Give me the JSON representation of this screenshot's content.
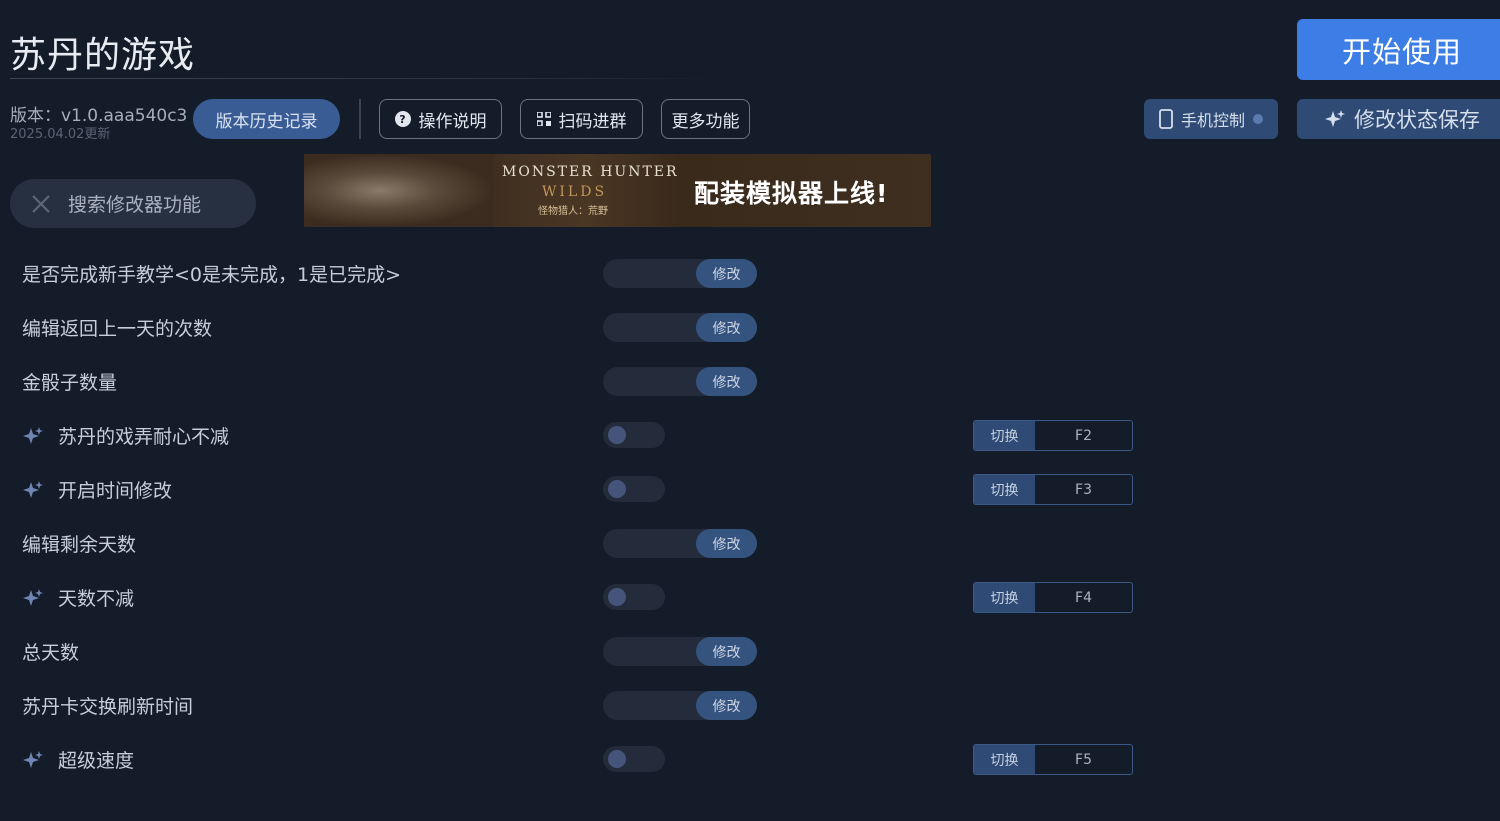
{
  "header": {
    "title": "苏丹的游戏",
    "start_label": "开始使用",
    "version": "版本：v1.0.aaa540c3",
    "updated": "2025.04.02更新"
  },
  "toolbar": {
    "history_label": "版本历史记录",
    "help_label": "操作说明",
    "qr_label": "扫码进群",
    "more_label": "更多功能",
    "phone_label": "手机控制",
    "save_label": "修改状态保存"
  },
  "search": {
    "placeholder": "搜索修改器功能"
  },
  "banner": {
    "game_title": "MONSTER HUNTER",
    "game_subtitle": "WILDS",
    "game_cn": "怪物猎人：荒野",
    "text": "配装模拟器上线!"
  },
  "options": [
    {
      "label": "是否完成新手教学<0是未完成，1是已完成>",
      "type": "modify",
      "button": "修改",
      "sparkle": false
    },
    {
      "label": "编辑返回上一天的次数",
      "type": "modify",
      "button": "修改",
      "sparkle": false
    },
    {
      "label": "金骰子数量",
      "type": "modify",
      "button": "修改",
      "sparkle": false
    },
    {
      "label": "苏丹的戏弄耐心不减",
      "type": "toggle",
      "switch": "切换",
      "key": "F2",
      "sparkle": true,
      "on": false
    },
    {
      "label": "开启时间修改",
      "type": "toggle",
      "switch": "切换",
      "key": "F3",
      "sparkle": true,
      "on": false
    },
    {
      "label": "编辑剩余天数",
      "type": "modify",
      "button": "修改",
      "sparkle": false
    },
    {
      "label": "天数不减",
      "type": "toggle",
      "switch": "切换",
      "key": "F4",
      "sparkle": true,
      "on": false
    },
    {
      "label": "总天数",
      "type": "modify",
      "button": "修改",
      "sparkle": false
    },
    {
      "label": "苏丹卡交换刷新时间",
      "type": "modify",
      "button": "修改",
      "sparkle": false
    },
    {
      "label": "超级速度",
      "type": "toggle",
      "switch": "切换",
      "key": "F5",
      "sparkle": true,
      "on": false
    }
  ],
  "icons": {
    "sparkle": "sparkle-icon",
    "help": "question-circle-icon",
    "qr": "qr-code-icon",
    "phone": "phone-icon",
    "close": "close-icon"
  },
  "colors": {
    "background": "#141b29",
    "accent": "#3d7de6",
    "button_dark": "#2f4b75"
  }
}
